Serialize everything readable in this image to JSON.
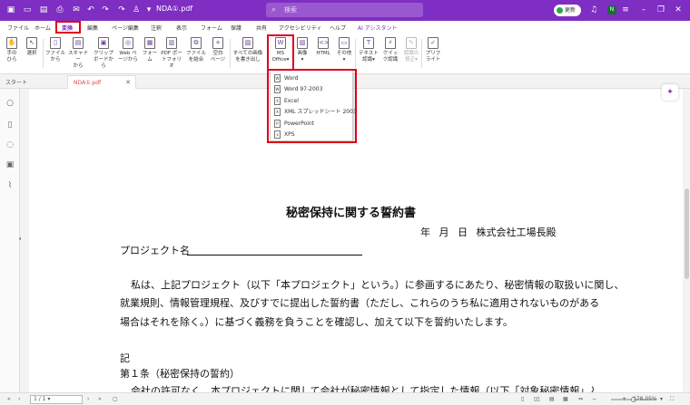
{
  "titlebar": {
    "filename": "NDA①.pdf",
    "search_placeholder": "検索",
    "update_label": "更新",
    "avatar_letter": "N"
  },
  "menu": {
    "items": [
      "ファイル",
      "ホーム",
      "変換",
      "編集",
      "ページ編集",
      "注釈",
      "表示",
      "フォーム",
      "保護",
      "共有",
      "アクセシビリティ",
      "ヘルプ",
      "AI アシスタント"
    ],
    "active_index": 2
  },
  "ribbon": {
    "buttons": [
      {
        "line1": "手の",
        "line2": "ひら",
        "icon": "hand-icon"
      },
      {
        "line1": "選択",
        "line2": "",
        "icon": "cursor-icon"
      },
      {
        "line1": "ファイル",
        "line2": "から",
        "icon": "file-icon"
      },
      {
        "line1": "スキャナー",
        "line2": "から",
        "icon": "scanner-icon"
      },
      {
        "line1": "クリップ",
        "line2": "ボードから",
        "icon": "clipboard-icon"
      },
      {
        "line1": "Web ペ",
        "line2": "ージから",
        "icon": "web-icon"
      },
      {
        "line1": "フォー",
        "line2": "ム",
        "icon": "form-icon"
      },
      {
        "line1": "PDF ポー",
        "line2": "トフォリオ",
        "icon": "portfolio-icon"
      },
      {
        "line1": "ファイル",
        "line2": "を結合",
        "icon": "merge-icon"
      },
      {
        "line1": "空白",
        "line2": "ページ",
        "icon": "blank-page-icon"
      },
      {
        "line1": "すべての画像",
        "line2": "を書き出し",
        "icon": "export-images-icon"
      },
      {
        "line1": "MS",
        "line2": "Office",
        "icon": "ms-office-icon"
      },
      {
        "line1": "画像",
        "line2": "",
        "icon": "image-icon"
      },
      {
        "line1": "HTML",
        "line2": "",
        "icon": "html-icon"
      },
      {
        "line1": "その他",
        "line2": "",
        "icon": "more-icon"
      },
      {
        "line1": "テキスト",
        "line2": "認識",
        "icon": "ocr-icon"
      },
      {
        "line1": "クイッ",
        "line2": "ク認識",
        "icon": "quick-ocr-icon"
      },
      {
        "line1": "認識の",
        "line2": "修正",
        "icon": "fix-ocr-icon"
      },
      {
        "line1": "プリフ",
        "line2": "ライト",
        "icon": "preflight-icon"
      }
    ]
  },
  "tabs": {
    "start": "スタート",
    "document": "NDA①.pdf"
  },
  "dropdown": {
    "items": [
      "Word",
      "Word 97-2003",
      "Excel",
      "XML スプレッドシート 2003",
      "PowerPoint",
      "XPS"
    ]
  },
  "document": {
    "title": "秘密保持に関する誓約書",
    "date_line": "年 月 日 株式会社工場長殿",
    "project_label": "プロジェクト名",
    "para1_line1": "私は、上記プロジェクト（以下「本プロジェクト」という。）に参画するにあたり、秘密情報の取扱いに関し、",
    "para1_line2": "就業規則、情報管理規程、及びすでに提出した誓約書（ただし、これらのうち私に適用されないものがある",
    "para1_line3": "場合はそれを除く。）に基づく義務を負うことを確認し、加えて以下を誓約いたします。",
    "ki": "記",
    "article1": "第１条（秘密保持の誓約）",
    "article1_body": "会社の許可なく、本プロジェクトに関して会社が秘密情報として指定した情報（以下「対象秘密情報」とい"
  },
  "statusbar": {
    "page": "1 / 1",
    "zoom": "178.05%",
    "zoom_fraction": 0.5
  },
  "colors": {
    "brand": "#7e2ec2",
    "highlight": "#e0001b"
  }
}
